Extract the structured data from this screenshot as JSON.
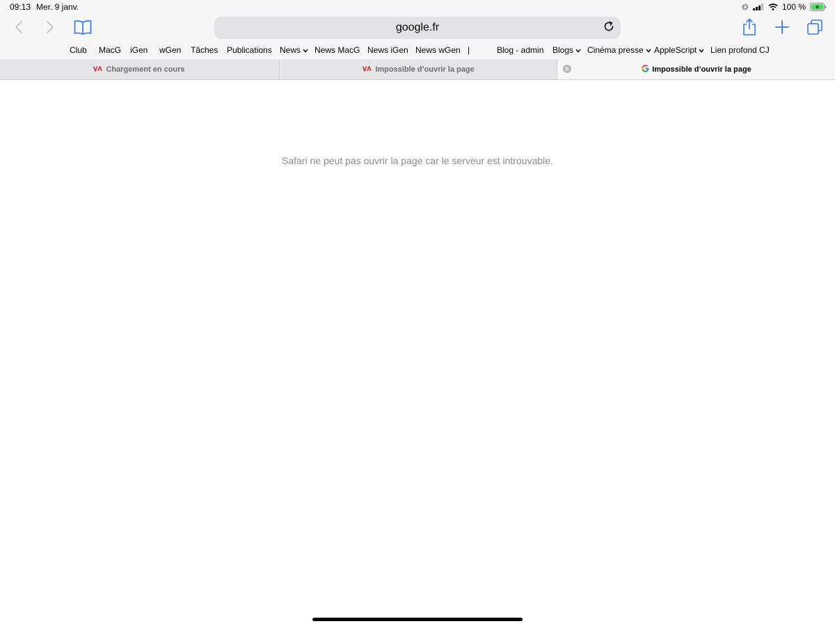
{
  "status_bar": {
    "time": "09:13",
    "date": "Mer. 9 janv.",
    "battery": "100 %",
    "icons": [
      "activity-icon",
      "signal-icon",
      "wifi-icon",
      "battery-icon"
    ]
  },
  "toolbar": {
    "address": "google.fr",
    "icons": [
      "back-icon",
      "forward-icon",
      "bookmarks-icon",
      "reload-icon",
      "share-icon",
      "new-tab-icon",
      "tabs-icon"
    ]
  },
  "bookmarks": [
    {
      "label": "Club"
    },
    {
      "label": "MacG"
    },
    {
      "label": "iGen"
    },
    {
      "label": "wGen"
    },
    {
      "label": "Tâches"
    },
    {
      "label": "Publications"
    },
    {
      "label": "News"
    },
    {
      "label": "News MacG"
    },
    {
      "label": "News iGen"
    },
    {
      "label": "News wGen"
    },
    {
      "label": "|"
    },
    {
      "label": "Blog - admin"
    },
    {
      "label": "Blogs"
    },
    {
      "label": "Cinéma presse"
    },
    {
      "label": "AppleScript"
    },
    {
      "label": "Lien profond CJ"
    }
  ],
  "tabs": [
    {
      "title": "Chargement en cours",
      "favicon": "macg-favicon-icon"
    },
    {
      "title": "Impossible d’ouvrir la page",
      "favicon": "macg-favicon-icon"
    },
    {
      "title": "Impossible d’ouvrir la page",
      "favicon": "google-favicon-icon",
      "active": true
    }
  ],
  "content": {
    "error_message": "Safari ne peut pas ouvrir la page car le serveur est introuvable."
  },
  "colors": {
    "accent": "#3478f6",
    "chrome_bg": "#f7f7f7",
    "address_bg": "#e3e3e6",
    "tab_bg": "#e6e6e8",
    "error_text": "#8a8a8e"
  }
}
